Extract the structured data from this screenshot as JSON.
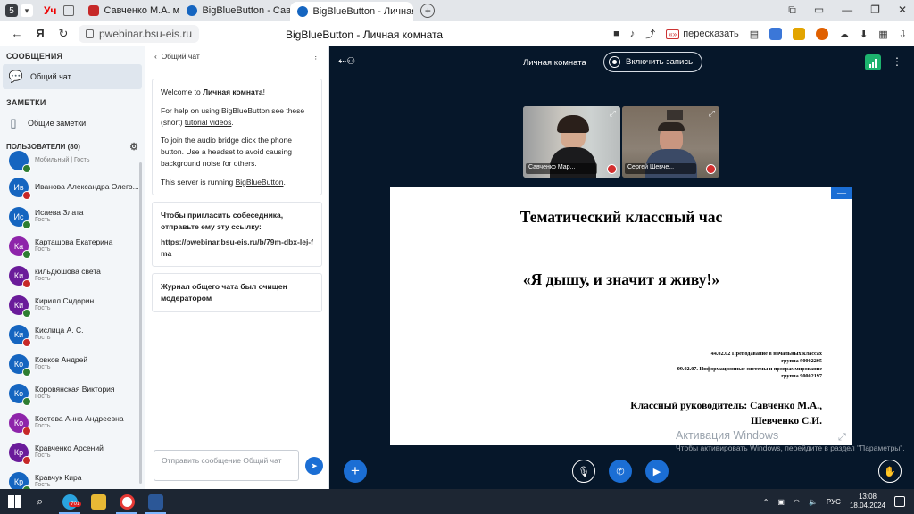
{
  "browser": {
    "tab_count": "5",
    "tabs": [
      {
        "title": "Савченко М.А. методика",
        "color": "#c62828"
      },
      {
        "title": "BigBlueButton - Савченко",
        "color": "#1565c0"
      },
      {
        "title": "BigBlueButton - Личная к",
        "color": "#1565c0"
      }
    ],
    "url": "pwebinar.bsu-eis.ru",
    "page_title": "BigBlueButton - Личная комната",
    "translate_label": "пересказать",
    "ya_label": "Уч"
  },
  "sidebar": {
    "messages_header": "СООБЩЕНИЯ",
    "public_chat": "Общий чат",
    "notes_header": "ЗАМЕТКИ",
    "shared_notes": "Общие заметки",
    "users_header": "ПОЛЬЗОВАТЕЛИ (80)",
    "users": [
      {
        "initials": "",
        "name": "",
        "role": "Мобильный | Гость",
        "color": "#1565c0",
        "mic": "#2e7d32"
      },
      {
        "initials": "Ив",
        "name": "Иванова Александра Олего...",
        "role": "",
        "color": "#1565c0",
        "mic": "#c62828"
      },
      {
        "initials": "Ис",
        "name": "Исаева Злата",
        "role": "Гость",
        "color": "#1565c0",
        "mic": "#2e7d32"
      },
      {
        "initials": "Ка",
        "name": "Карташова Екатерина",
        "role": "Гость",
        "color": "#8e24aa",
        "mic": "#2e7d32"
      },
      {
        "initials": "Ки",
        "name": "кильдюшова света",
        "role": "Гость",
        "color": "#6a1b9a",
        "mic": "#c62828"
      },
      {
        "initials": "Ки",
        "name": "Кирилл Сидорин",
        "role": "Гость",
        "color": "#6a1b9a",
        "mic": "#2e7d32"
      },
      {
        "initials": "Ки",
        "name": "Кислица А. С.",
        "role": "Гость",
        "color": "#1565c0",
        "mic": "#c62828"
      },
      {
        "initials": "Ко",
        "name": "Ковков Андрей",
        "role": "Гость",
        "color": "#1565c0",
        "mic": "#2e7d32"
      },
      {
        "initials": "Ко",
        "name": "Коровянская Виктория",
        "role": "Гость",
        "color": "#1565c0",
        "mic": "#2e7d32"
      },
      {
        "initials": "Ко",
        "name": "Костева Анна Андреевна",
        "role": "Гость",
        "color": "#8e24aa",
        "mic": "#c62828"
      },
      {
        "initials": "Кр",
        "name": "Кравченко Арсений",
        "role": "Гость",
        "color": "#6a1b9a",
        "mic": "#c62828"
      },
      {
        "initials": "Кр",
        "name": "Кравчук Кира",
        "role": "Гость",
        "color": "#1565c0",
        "mic": "#2e7d32"
      }
    ]
  },
  "chat": {
    "title": "Общий чат",
    "welcome_prefix": "Welcome to ",
    "welcome_room": "Личная комната",
    "welcome_suffix": "!",
    "help_prefix": "For help on using BigBlueButton see these (short) ",
    "help_link": "tutorial videos",
    "help_suffix": ".",
    "audio_text": "To join the audio bridge click the phone button. Use a headset to avoid causing background noise for others.",
    "server_prefix": "This server is running ",
    "server_link": "BigBlueButton",
    "server_suffix": ".",
    "invite_title": "Чтобы пригласить собеседника, отправьте ему эту ссылку:",
    "invite_link": "https://pwebinar.bsu-eis.ru/b/79m-dbx-lej-fma",
    "cleared": "Журнал общего чата был очищен модератором",
    "input_placeholder": "Отправить сообщение Общий чат"
  },
  "main": {
    "room_name": "Личная комната",
    "record_label": "Включить запись",
    "videos": [
      {
        "name": "Савченко Мар...",
        "bg": "#8c8e8f"
      },
      {
        "name": "Сергей Шевче...",
        "bg": "#7d6b5a"
      }
    ]
  },
  "slide": {
    "title": "Тематический классный час",
    "quote": "«Я дышу, и значит я живу!»",
    "line1": "44.02.02 Преподавание в начальных классах",
    "line2": "группа 90002205",
    "line3": "09.02.07. Информационные системы и программирование",
    "line4": "группа 90002197",
    "teacher1": "Классный руководитель: Савченко М.А.,",
    "teacher2": "Шевченко С.И."
  },
  "watermark": {
    "title": "Активация Windows",
    "subtitle": "Чтобы активировать Windows, перейдите в раздел \"Параметры\"."
  },
  "taskbar": {
    "telegram_badge": "701",
    "lang": "РУС",
    "time": "13:08",
    "date": "18.04.2024"
  }
}
